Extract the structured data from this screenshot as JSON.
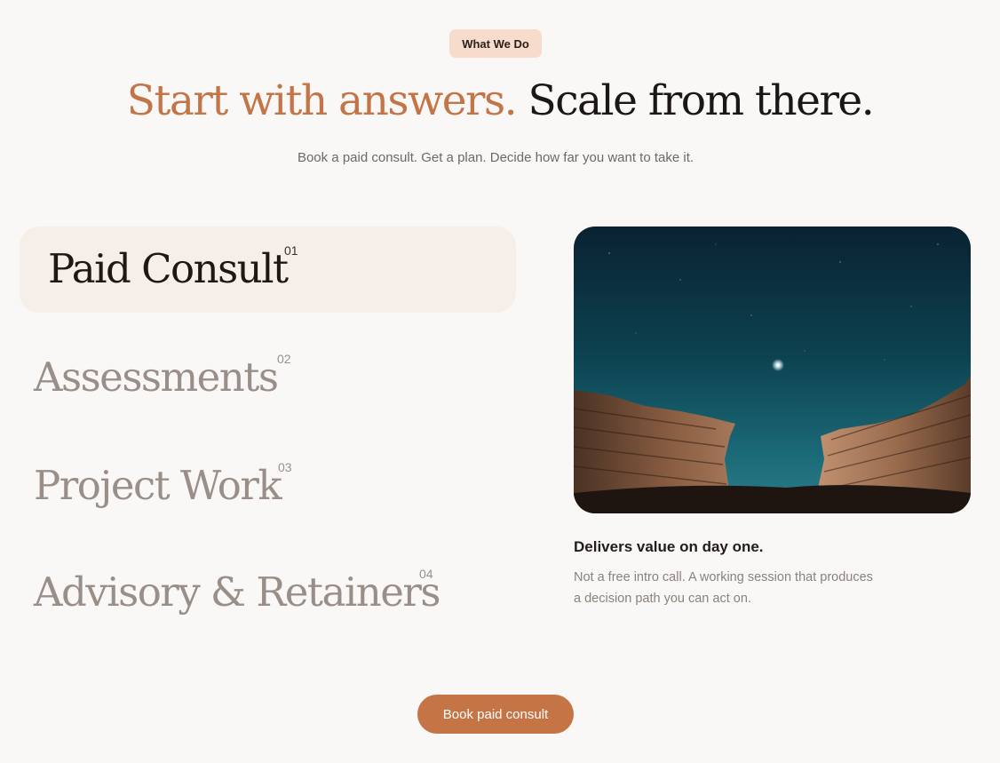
{
  "section": {
    "badge": "What We Do",
    "headline_accent": "Start with answers.",
    "headline_rest": "Scale from there.",
    "subhead": "Book a paid consult. Get a plan. Decide how far you want to take it."
  },
  "services": [
    {
      "label": "Paid Consult",
      "num": "01",
      "active": true
    },
    {
      "label": "Assessments",
      "num": "02",
      "active": false
    },
    {
      "label": "Project Work",
      "num": "03",
      "active": false
    },
    {
      "label": "Advisory & Retainers",
      "num": "04",
      "active": false
    }
  ],
  "detail": {
    "title": "Delivers value on day one.",
    "body": "Not a free intro call. A working session that produces a decision path you can act on."
  },
  "cta": {
    "label": "Book paid consult"
  },
  "colors": {
    "accent": "#c37548",
    "badge_bg": "#f8dccb",
    "active_bg": "#f6eee8",
    "muted_text": "#9a8f88",
    "page_bg": "#faf8f6"
  }
}
